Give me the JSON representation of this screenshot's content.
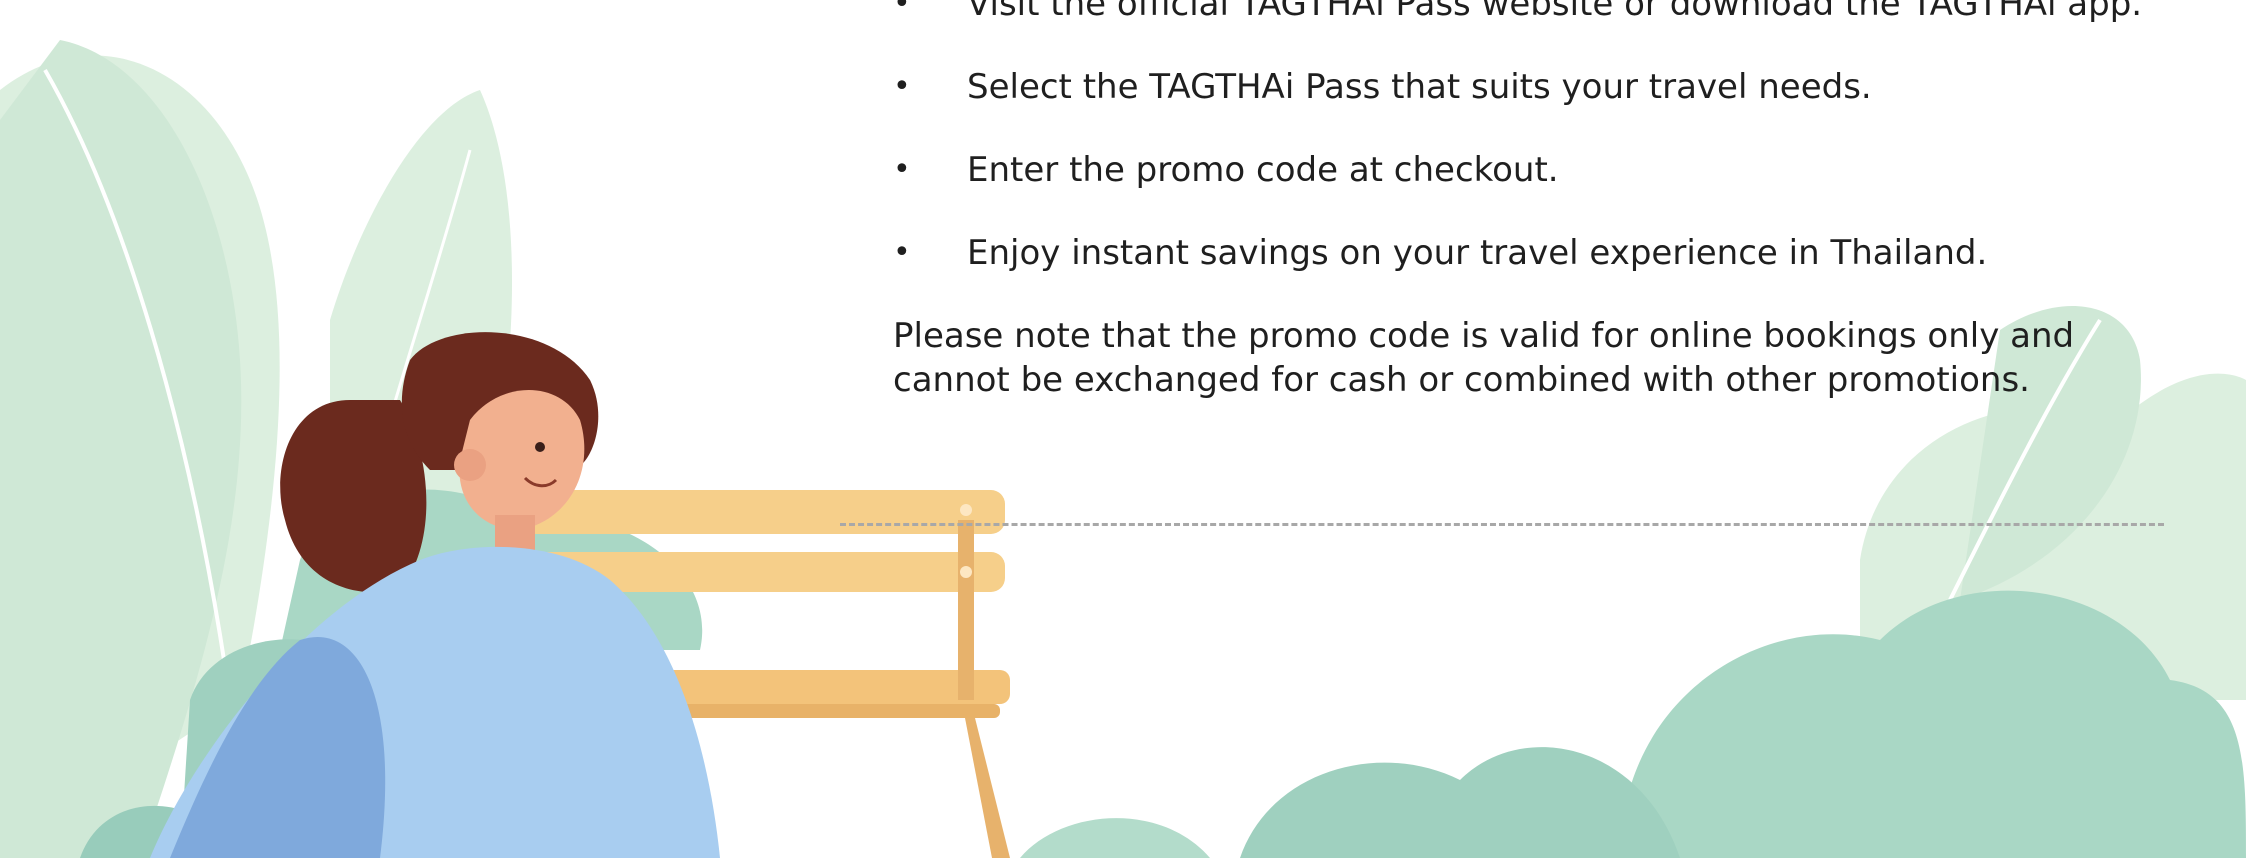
{
  "steps": [
    "Visit the official TAGTHAi Pass website or download the TAGTHAi app.",
    "Select the TAGTHAi Pass that suits your travel needs.",
    "Enter the promo code at checkout.",
    "Enjoy instant savings on your travel experience in Thailand."
  ],
  "bullet_symbol": "•",
  "note": "Please note that the promo code is valid for online bookings only and cannot be exchanged for cash or combined with other promotions.",
  "colors": {
    "text": "#1f1f1f",
    "foliage_light": "#d6ecdc",
    "foliage_mid": "#a9d7c5",
    "bench": "#f6cf8a",
    "sweater": "#a8cdf0",
    "hair": "#6b2a1e",
    "skin": "#f2b08f",
    "divider": "#a8a8a8"
  },
  "illustration": {
    "subject_icon": "woman-on-bench-illustration",
    "background_icon": "plants-foliage-illustration"
  }
}
